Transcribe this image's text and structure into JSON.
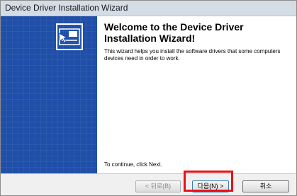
{
  "window": {
    "title": "Device Driver Installation Wizard"
  },
  "banner": {
    "icon": "driver-disk-icon"
  },
  "content": {
    "heading": "Welcome to the Device Driver Installation Wizard!",
    "intro": "This wizard helps you install the software drivers that some computers devices need in order to work.",
    "continue_hint": "To continue, click Next."
  },
  "buttons": {
    "back_label": "< 뒤로(B)",
    "next_label": "다음(N) >",
    "cancel_label": "취소"
  },
  "colors": {
    "banner": "#1f4fa8",
    "highlight": "#e8121a"
  }
}
